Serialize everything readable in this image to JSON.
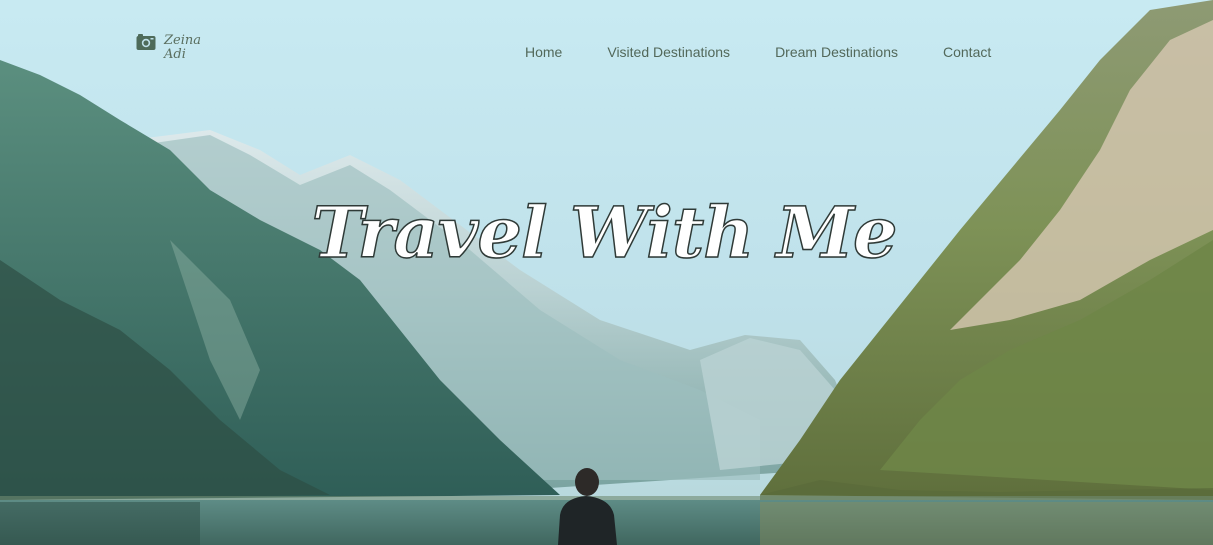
{
  "brand": {
    "name_line1": "Zeina",
    "name_line2": "Adi",
    "icon": "camera-icon"
  },
  "nav": {
    "items": [
      {
        "label": "Home"
      },
      {
        "label": "Visited Destinations"
      },
      {
        "label": "Dream Destinations"
      },
      {
        "label": "Contact"
      }
    ]
  },
  "hero": {
    "title": "Travel With Me",
    "background_image": "mountain-lake-photo"
  },
  "colors": {
    "sky": "#bfe3ea",
    "nav_text": "#52685a",
    "title_fill": "#ffffff",
    "title_outline": "#2f3a37"
  }
}
